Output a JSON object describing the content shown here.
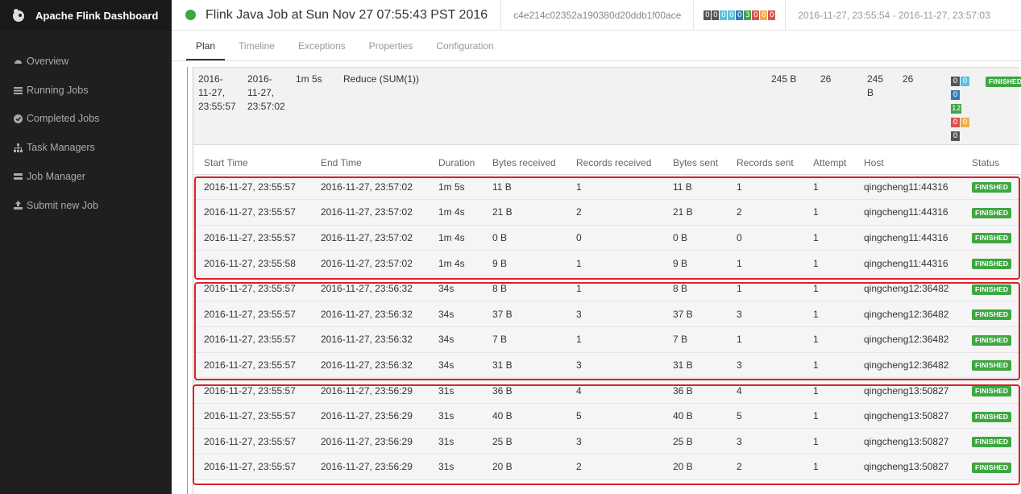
{
  "brand": {
    "title": "Apache Flink Dashboard"
  },
  "sidebar": {
    "items": [
      {
        "label": "Overview",
        "icon": "dashboard-icon"
      },
      {
        "label": "Running Jobs",
        "icon": "tasks-icon"
      },
      {
        "label": "Completed Jobs",
        "icon": "check-circle-icon"
      },
      {
        "label": "Task Managers",
        "icon": "sitemap-icon"
      },
      {
        "label": "Job Manager",
        "icon": "server-icon"
      },
      {
        "label": "Submit new Job",
        "icon": "upload-icon"
      }
    ]
  },
  "header": {
    "job_title": "Flink Java Job at Sun Nov 27 07:55:43 PST 2016",
    "job_id": "c4e214c02352a190380d20ddb1f00ace",
    "task_counts": [
      "0",
      "0",
      "0",
      "0",
      "0",
      "3",
      "0",
      "0",
      "0"
    ],
    "task_count_colors": [
      "#555555",
      "#555555",
      "#5bc0de",
      "#5bc0de",
      "#337ab7",
      "#3ea742",
      "#d9534f",
      "#f0ad4e",
      "#d9534f"
    ],
    "time_range": "2016-11-27, 23:55:54 - 2016-11-27, 23:57:03"
  },
  "tabs": [
    "Plan",
    "Timeline",
    "Exceptions",
    "Properties",
    "Configuration"
  ],
  "vertex": {
    "start": "2016-\n11-27,\n23:55:57",
    "end": "2016-\n11-27,\n23:57:02",
    "duration": "1m 5s",
    "name": "Reduce (SUM(1))",
    "bytes_received": "245 B",
    "records_received": "26",
    "bytes_sent": "245\nB",
    "records_sent": "26",
    "status": "FINISHED",
    "badges": [
      {
        "v": "0",
        "c": "#555555"
      },
      {
        "v": "0",
        "c": "#5bc0de"
      },
      {
        "v": "0",
        "c": "#337ab7"
      },
      {
        "v": "12",
        "c": "#3ea742"
      },
      {
        "v": "0",
        "c": "#d9534f"
      },
      {
        "v": "0",
        "c": "#f0ad4e"
      },
      {
        "v": "0",
        "c": "#555555"
      }
    ]
  },
  "subtasks": {
    "columns": [
      "Start Time",
      "End Time",
      "Duration",
      "Bytes received",
      "Records received",
      "Bytes sent",
      "Records sent",
      "Attempt",
      "Host",
      "Status"
    ],
    "rows": [
      [
        "2016-11-27, 23:55:57",
        "2016-11-27, 23:57:02",
        "1m 5s",
        "11 B",
        "1",
        "11 B",
        "1",
        "1",
        "qingcheng11:44316",
        "FINISHED"
      ],
      [
        "2016-11-27, 23:55:57",
        "2016-11-27, 23:57:02",
        "1m 4s",
        "21 B",
        "2",
        "21 B",
        "2",
        "1",
        "qingcheng11:44316",
        "FINISHED"
      ],
      [
        "2016-11-27, 23:55:57",
        "2016-11-27, 23:57:02",
        "1m 4s",
        "0 B",
        "0",
        "0 B",
        "0",
        "1",
        "qingcheng11:44316",
        "FINISHED"
      ],
      [
        "2016-11-27, 23:55:58",
        "2016-11-27, 23:57:02",
        "1m 4s",
        "9 B",
        "1",
        "9 B",
        "1",
        "1",
        "qingcheng11:44316",
        "FINISHED"
      ],
      [
        "2016-11-27, 23:55:57",
        "2016-11-27, 23:56:32",
        "34s",
        "8 B",
        "1",
        "8 B",
        "1",
        "1",
        "qingcheng12:36482",
        "FINISHED"
      ],
      [
        "2016-11-27, 23:55:57",
        "2016-11-27, 23:56:32",
        "34s",
        "37 B",
        "3",
        "37 B",
        "3",
        "1",
        "qingcheng12:36482",
        "FINISHED"
      ],
      [
        "2016-11-27, 23:55:57",
        "2016-11-27, 23:56:32",
        "34s",
        "7 B",
        "1",
        "7 B",
        "1",
        "1",
        "qingcheng12:36482",
        "FINISHED"
      ],
      [
        "2016-11-27, 23:55:57",
        "2016-11-27, 23:56:32",
        "34s",
        "31 B",
        "3",
        "31 B",
        "3",
        "1",
        "qingcheng12:36482",
        "FINISHED"
      ],
      [
        "2016-11-27, 23:55:57",
        "2016-11-27, 23:56:29",
        "31s",
        "36 B",
        "4",
        "36 B",
        "4",
        "1",
        "qingcheng13:50827",
        "FINISHED"
      ],
      [
        "2016-11-27, 23:55:57",
        "2016-11-27, 23:56:29",
        "31s",
        "40 B",
        "5",
        "40 B",
        "5",
        "1",
        "qingcheng13:50827",
        "FINISHED"
      ],
      [
        "2016-11-27, 23:55:57",
        "2016-11-27, 23:56:29",
        "31s",
        "25 B",
        "3",
        "25 B",
        "3",
        "1",
        "qingcheng13:50827",
        "FINISHED"
      ],
      [
        "2016-11-27, 23:55:57",
        "2016-11-27, 23:56:29",
        "31s",
        "20 B",
        "2",
        "20 B",
        "2",
        "1",
        "qingcheng13:50827",
        "FINISHED"
      ]
    ]
  },
  "colors": {
    "finished": "#3ea742",
    "highlight": "#d9202a",
    "sidebar_bg": "#1f1f1f"
  }
}
